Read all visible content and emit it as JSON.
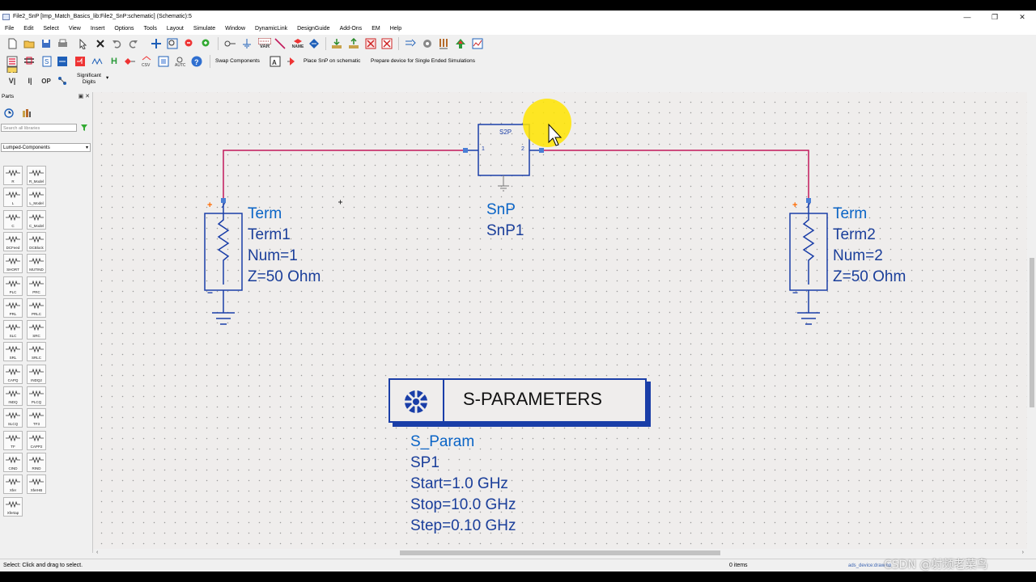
{
  "window": {
    "title": "File2_SnP [Imp_Match_Basics_lib:File2_SnP:schematic] (Schematic):5",
    "controls": {
      "minimize": "—",
      "restore": "❐",
      "close": "✕"
    }
  },
  "menu": [
    "File",
    "Edit",
    "Select",
    "View",
    "Insert",
    "Options",
    "Tools",
    "Layout",
    "Simulate",
    "Window",
    "DynamicLink",
    "DesignGuide",
    "Add-Ons",
    "EM",
    "Help"
  ],
  "toolbar2": {
    "swap_label": "Swap Components",
    "place_snp_label": "Place SnP on schematic",
    "prepare_label": "Prepare device for Single Ended Simulations"
  },
  "toolbar3": {
    "significant_digits": "Significant Digits",
    "var_label": "VAR",
    "name_label": "NAME"
  },
  "parts_panel": {
    "title": "Parts",
    "search_placeholder": "Search all libraries",
    "library": "Lumped-Components",
    "items": [
      "R",
      "R_Model",
      "L",
      "L_Model",
      "C",
      "C_Model",
      "DCFeed",
      "DCBlock",
      "SHORT",
      "MUTIND",
      "PLC",
      "PRC",
      "PRL",
      "PRLC",
      "SLC",
      "SRC",
      "SRL",
      "SRLC",
      "CAPQ",
      "INDQ2",
      "INDQ",
      "PLCQ",
      "SLCQ",
      "TF3",
      "TF",
      "CAPP2",
      "CIND",
      "RIND",
      "Xfer",
      "XferHB",
      "Xfertap"
    ]
  },
  "schematic": {
    "snp_box": {
      "title": "S2P",
      "port1": "1",
      "port2": "2",
      "type": "SnP",
      "name": "SnP1"
    },
    "term1": {
      "type": "Term",
      "name": "Term1",
      "num": "Num=1",
      "z": "Z=50 Ohm",
      "plus": "+",
      "minus": "−"
    },
    "term2": {
      "type": "Term",
      "name": "Term2",
      "num": "Num=2",
      "z": "Z=50 Ohm",
      "plus": "+",
      "minus": "−"
    },
    "sparam": {
      "header": "S-PARAMETERS",
      "type": "S_Param",
      "name": "SP1",
      "start": "Start=1.0 GHz",
      "stop": "Stop=10.0 GHz",
      "step": "Step=0.10 GHz"
    }
  },
  "statusbar": {
    "hint": "Select: Click and drag to select.",
    "items": "0 items",
    "device": "ads_device:drawing"
  },
  "watermark": "CSDN @射频老菜鸟",
  "colors": {
    "wire": "#c2185b",
    "component": "#1a3ea8",
    "label": "#0a64c6",
    "pin": "#4a7fd6",
    "orange": "#ff6a00"
  }
}
